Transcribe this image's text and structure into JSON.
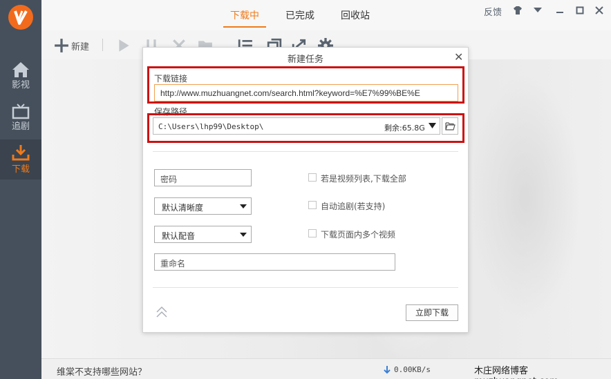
{
  "sidebar": {
    "items": [
      {
        "label": "影视",
        "icon": "home-icon"
      },
      {
        "label": "追剧",
        "icon": "tv-icon"
      },
      {
        "label": "下载",
        "icon": "download-icon"
      }
    ],
    "active_color": "#f07a1a"
  },
  "topbar": {
    "tabs": [
      {
        "label": "下载中"
      },
      {
        "label": "已完成"
      },
      {
        "label": "回收站"
      }
    ],
    "feedback_label": "反馈"
  },
  "toolbar": {
    "new_label": "新建"
  },
  "dialog": {
    "title": "新建任务",
    "url_label": "下载链接",
    "url_value": "http://www.muzhuangnet.com/search.html?keyword=%E7%99%BE%E",
    "path_label": "保存路径",
    "path_value": "C:\\Users\\lhp99\\Desktop\\",
    "free_space": "剩余:65.8G",
    "password_placeholder": "密码",
    "quality_selected": "默认清晰度",
    "audio_selected": "默认配音",
    "rename_placeholder": "重命名",
    "options": [
      {
        "label": "若是视频列表,下载全部",
        "checked": false
      },
      {
        "label": "自动追剧(若支持)",
        "checked": false
      },
      {
        "label": "下载页面内多个视频",
        "checked": false
      }
    ],
    "download_now_label": "立即下载"
  },
  "statusbar": {
    "unsupported_link": "维棠不支持哪些网站？",
    "speed": "0.00KB/s",
    "watermark": "木庄网络博客 muzhuangnet.com"
  },
  "colors": {
    "accent": "#f07a1a",
    "sidebar_bg": "#46505c",
    "highlight_box": "#cc1111"
  }
}
